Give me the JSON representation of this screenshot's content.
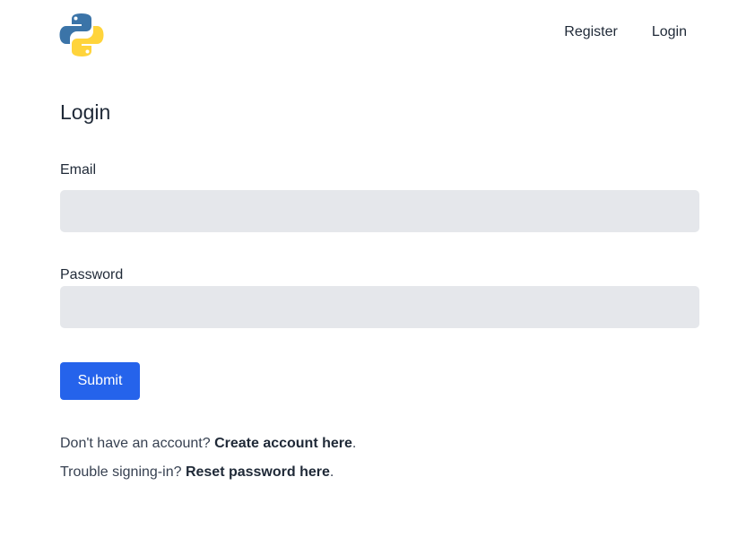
{
  "header": {
    "logo_icon": "python-logo-icon",
    "nav": {
      "register_label": "Register",
      "login_label": "Login"
    }
  },
  "form": {
    "title": "Login",
    "email_label": "Email",
    "email_value": "",
    "password_label": "Password",
    "password_value": "",
    "submit_label": "Submit"
  },
  "footer_links": {
    "create_prefix": "Don't have an account? ",
    "create_link": "Create account here",
    "create_suffix": ".",
    "reset_prefix": "Trouble signing-in? ",
    "reset_link": "Reset password here",
    "reset_suffix": "."
  },
  "colors": {
    "accent": "#2563eb",
    "input_bg": "#e5e7eb",
    "text": "#1f2937",
    "logo_blue": "#3b74a8",
    "logo_yellow": "#ffd43b"
  }
}
